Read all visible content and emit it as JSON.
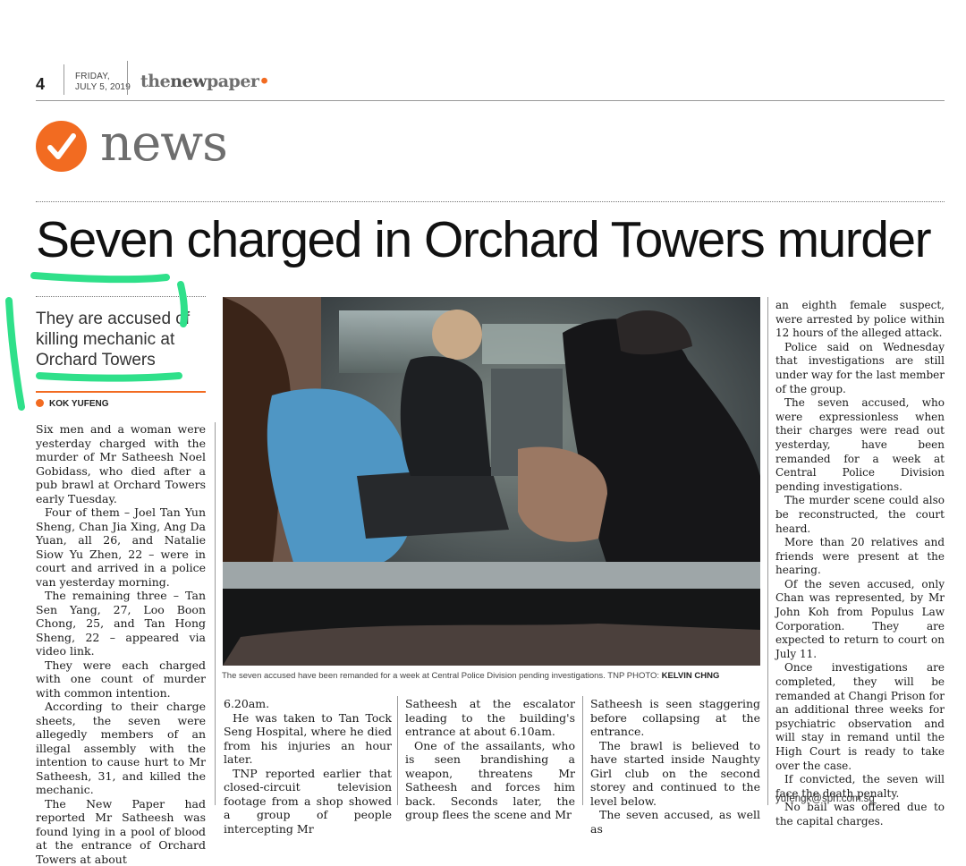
{
  "masthead": {
    "page_number": "4",
    "day": "FRIDAY,",
    "date": "JULY 5, 2019",
    "brand_the": "the",
    "brand_new": "new",
    "brand_paper": "paper"
  },
  "section": {
    "label": "news"
  },
  "article": {
    "headline": "Seven charged in Orchard Towers murder",
    "standfirst_lines": [
      "They are accused of",
      "killing mechanic at",
      "Orchard Towers"
    ],
    "byline": "KOK YUFENG",
    "caption_text": "The seven accused have been remanded for a week at Central Police Division pending investigations. TNP PHOTO: ",
    "caption_credit": "KELVIN CHNG",
    "col1": [
      "Six men and a woman were yesterday charged with the murder of Mr Satheesh Noel Gobidass, who died after a pub brawl at Orchard Towers early Tuesday.",
      "Four of them – Joel Tan Yun Sheng, Chan Jia Xing, Ang Da Yuan, all 26, and Natalie Siow Yu Zhen, 22 – were in court and arrived in a police van yesterday morning.",
      "The remaining three – Tan Sen Yang, 27, Loo Boon Chong, 25, and Tan Hong Sheng, 22 – appeared via video link.",
      "They were each charged with one count of murder with common intention.",
      "According to their charge sheets, the seven were allegedly members of an illegal assembly with the intention to cause hurt to Mr Satheesh, 31, and killed the mechanic.",
      "The New Paper had reported Mr Satheesh was found lying in a pool of blood at the entrance of Orchard Towers at about"
    ],
    "col2": [
      "6.20am.",
      "He was taken to Tan Tock Seng Hospital, where he died from his injuries an hour later.",
      "TNP reported earlier that closed-circuit television footage from a shop showed a group of people intercepting Mr"
    ],
    "col3": [
      "Satheesh at the escalator leading to the building's entrance at about 6.10am.",
      "One of the assailants, who is seen brandishing a weapon, threatens Mr Satheesh and forces him back. Seconds later, the group flees the scene and Mr"
    ],
    "col4": [
      "Satheesh is seen staggering before collapsing at the entrance.",
      "The brawl is believed to have started inside Naughty Girl club on the second storey and continued to the level below.",
      "The seven accused, as well as"
    ],
    "col5": [
      "an eighth female suspect, were arrested by police within 12 hours of the alleged attack.",
      "Police said on Wednesday that investigations are still under way for the last member of the group.",
      "The seven accused, who were expressionless when their charges were read out yesterday, have been remanded for a week at Central Police Division pending investigations.",
      "The murder scene could also be reconstructed, the court heard.",
      "More than 20 relatives and friends were present at the hearing.",
      "Of the seven accused, only Chan was represented, by Mr John Koh from Populus Law Corporation. They are expected to return to court on July 11.",
      "Once investigations are completed, they will be remanded at Changi Prison for an additional three weeks for psychiatric observation and will stay in remand until the High Court is ready to take over the case.",
      "If convicted, the seven will face the death penalty.",
      "No bail was offered due to the capital charges."
    ],
    "email": "yufengk@sph.com.sg"
  },
  "colors": {
    "brand_orange": "#f26b21",
    "highlight_green": "#2fe08a",
    "section_grey": "#6e6e6e"
  },
  "icons": {
    "section": "check-icon"
  }
}
